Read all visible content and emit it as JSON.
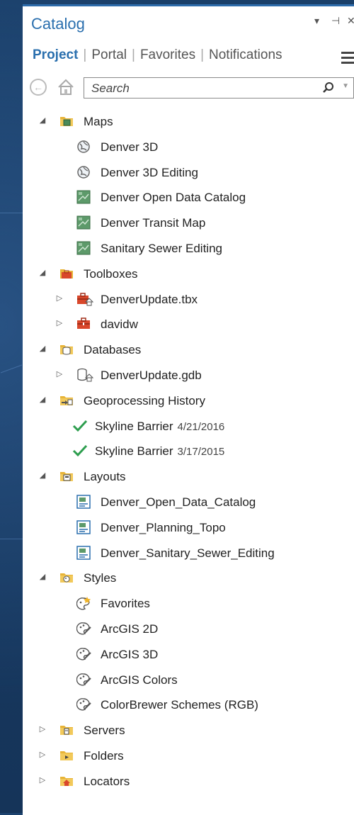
{
  "panel": {
    "title": "Catalog",
    "title_controls": [
      "▾",
      "⊣",
      "✕"
    ]
  },
  "tabs": [
    {
      "label": "Project",
      "active": true
    },
    {
      "label": "Portal",
      "active": false
    },
    {
      "label": "Favorites",
      "active": false
    },
    {
      "label": "Notifications",
      "active": false
    }
  ],
  "search": {
    "placeholder": "Search",
    "value": ""
  },
  "colors": {
    "accent": "#2a6fae",
    "success": "#2e9e4f",
    "folder": "#e8b437"
  },
  "tree": [
    {
      "label": "Maps",
      "expanded": true,
      "icon": "maps-folder-icon",
      "children": [
        {
          "label": "Denver 3D",
          "icon": "globe-scene-icon"
        },
        {
          "label": "Denver 3D Editing",
          "icon": "globe-scene-icon"
        },
        {
          "label": "Denver Open Data Catalog",
          "icon": "map-icon"
        },
        {
          "label": "Denver Transit Map",
          "icon": "map-icon"
        },
        {
          "label": "Sanitary Sewer Editing",
          "icon": "map-icon"
        }
      ]
    },
    {
      "label": "Toolboxes",
      "expanded": true,
      "icon": "toolboxes-folder-icon",
      "children": [
        {
          "label": "DenverUpdate.tbx",
          "icon": "toolbox-home-icon",
          "expandable": true
        },
        {
          "label": "davidw",
          "icon": "toolbox-icon",
          "expandable": true
        }
      ]
    },
    {
      "label": "Databases",
      "expanded": true,
      "icon": "databases-folder-icon",
      "children": [
        {
          "label": "DenverUpdate.gdb",
          "icon": "geodatabase-home-icon",
          "expandable": true
        }
      ]
    },
    {
      "label": "Geoprocessing History",
      "expanded": true,
      "icon": "geoprocessing-history-icon",
      "children": [
        {
          "label": "Skyline Barrier",
          "date": "4/21/2016",
          "icon": "success-check-icon"
        },
        {
          "label": "Skyline Barrier",
          "date": "3/17/2015",
          "icon": "success-check-icon"
        }
      ]
    },
    {
      "label": "Layouts",
      "expanded": true,
      "icon": "layouts-folder-icon",
      "children": [
        {
          "label": "Denver_Open_Data_Catalog",
          "icon": "layout-icon"
        },
        {
          "label": "Denver_Planning_Topo",
          "icon": "layout-icon"
        },
        {
          "label": "Denver_Sanitary_Sewer_Editing",
          "icon": "layout-icon"
        }
      ]
    },
    {
      "label": "Styles",
      "expanded": true,
      "icon": "styles-folder-icon",
      "children": [
        {
          "label": "Favorites",
          "icon": "style-favorites-icon"
        },
        {
          "label": "ArcGIS 2D",
          "icon": "style-icon"
        },
        {
          "label": "ArcGIS 3D",
          "icon": "style-icon"
        },
        {
          "label": "ArcGIS Colors",
          "icon": "style-icon"
        },
        {
          "label": "ColorBrewer Schemes (RGB)",
          "icon": "style-icon"
        }
      ]
    },
    {
      "label": "Servers",
      "expanded": false,
      "icon": "servers-folder-icon"
    },
    {
      "label": "Folders",
      "expanded": false,
      "icon": "folders-folder-icon"
    },
    {
      "label": "Locators",
      "expanded": false,
      "icon": "locators-folder-icon"
    }
  ]
}
